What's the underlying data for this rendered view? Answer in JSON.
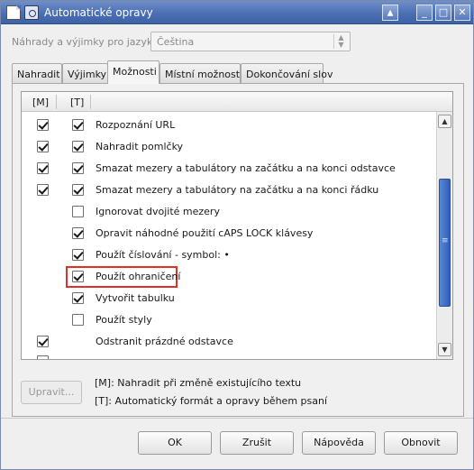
{
  "window": {
    "title": "Automatické opravy"
  },
  "language": {
    "label": "Náhrady a výjimky pro jazyk:",
    "selected": "Čeština"
  },
  "tabs": [
    {
      "label": "Nahradit"
    },
    {
      "label": "Výjimky"
    },
    {
      "label": "Možnosti",
      "active": true
    },
    {
      "label": "Místní možnosti"
    },
    {
      "label": "Dokončování slov"
    }
  ],
  "list": {
    "columns": [
      "[M]",
      "[T]"
    ],
    "rows": [
      {
        "m": true,
        "t": true,
        "label": "Rozpoznání URL"
      },
      {
        "m": true,
        "t": true,
        "label": "Nahradit pomlčky"
      },
      {
        "m": true,
        "t": true,
        "label": "Smazat mezery a tabulátory na začátku a na konci odstavce"
      },
      {
        "m": true,
        "t": true,
        "label": "Smazat mezery a tabulátory na začátku a na konci řádku"
      },
      {
        "m": null,
        "t": false,
        "label": "Ignorovat dvojité mezery"
      },
      {
        "m": null,
        "t": true,
        "label": "Opravit náhodné použití cAPS LOCK klávesy"
      },
      {
        "m": null,
        "t": true,
        "label": "Použít číslování - symbol: •"
      },
      {
        "m": null,
        "t": true,
        "label": "Použít ohraničení",
        "highlighted": true
      },
      {
        "m": null,
        "t": true,
        "label": "Vytvořit tabulku"
      },
      {
        "m": null,
        "t": false,
        "label": "Použít styly"
      },
      {
        "m": true,
        "t": null,
        "label": "Odstranit prázdné odstavce"
      }
    ]
  },
  "edit_button": "Upravit...",
  "legend": {
    "m": "[M]: Nahradit při změně existujícího textu",
    "t": "[T]: Automatický formát a opravy během psaní"
  },
  "footer": {
    "ok": "OK",
    "cancel": "Zrušit",
    "help": "Nápověda",
    "reset": "Obnovit"
  },
  "colors": {
    "titlebar": "#4b6fb2",
    "highlight_box": "#e0302a",
    "scroll_thumb": "#2f5fbf"
  }
}
